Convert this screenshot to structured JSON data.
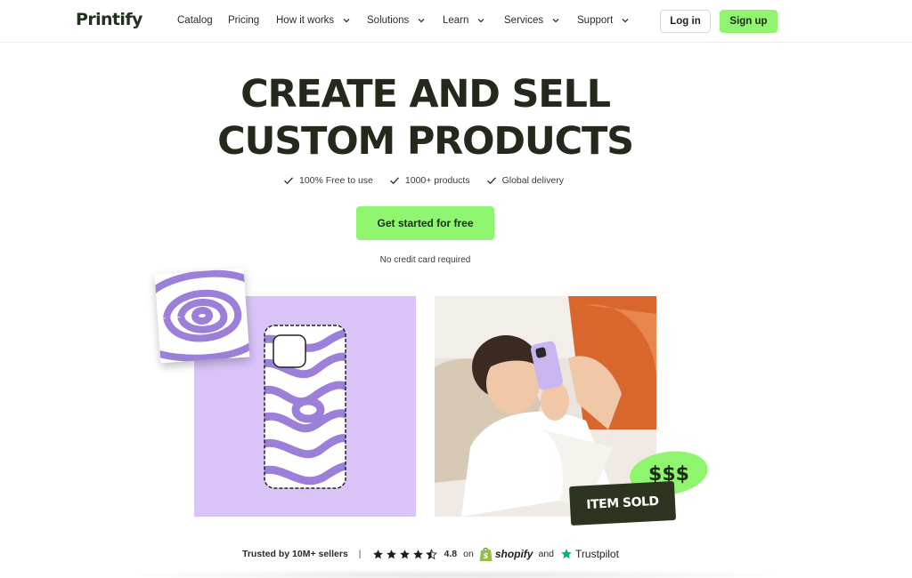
{
  "nav": {
    "logo": "Printify",
    "links": [
      {
        "label": "Catalog",
        "dropdown": false
      },
      {
        "label": "Pricing",
        "dropdown": false
      },
      {
        "label": "How it works",
        "dropdown": true
      },
      {
        "label": "Solutions",
        "dropdown": true
      },
      {
        "label": "Learn",
        "dropdown": true
      },
      {
        "label": "Services",
        "dropdown": true
      },
      {
        "label": "Support",
        "dropdown": true
      }
    ],
    "login_label": "Log in",
    "signup_label": "Sign up"
  },
  "hero": {
    "title_line1": "CREATE AND SELL",
    "title_line2": "CUSTOM PRODUCTS",
    "features": [
      "100% Free to use",
      "1000+ products",
      "Global delivery"
    ],
    "cta_label": "Get started for free",
    "cta_note": "No credit card required"
  },
  "showcase": {
    "money_badge": "$$$",
    "sold_badge": "ITEM SOLD"
  },
  "trust": {
    "sellers": "Trusted by 10M+ sellers",
    "separator": "|",
    "rating": "4.8",
    "rating_stars": 4.5,
    "on_word": "on",
    "shopify": "shopify",
    "and_word": "and",
    "trustpilot": "Trustpilot"
  },
  "colors": {
    "brand_green": "#8ff56e",
    "dark_olive": "#232a1c",
    "lavender": "#d9c3f7",
    "swirl_purple": "#9b7fd9"
  }
}
